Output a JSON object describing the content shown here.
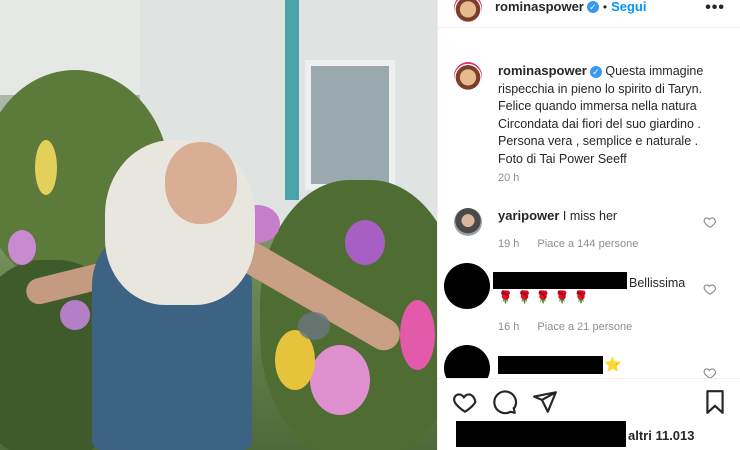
{
  "post": {
    "username": "rominaspower",
    "follow_label": "Segui",
    "more_label": "•••",
    "caption_lines": [
      "Questa immagine",
      "rispecchia in pieno lo spirito di Taryn.",
      "Felice quando immersa nella natura",
      "Circondata dai fiori del suo giardino .",
      "Persona vera , semplice e naturale .",
      "Foto di Tai Power Seeff"
    ],
    "caption_time": "20 h"
  },
  "comments": [
    {
      "username": "yaripower",
      "text": "I miss her",
      "time": "19 h",
      "likes": "Piace a 144 persone"
    },
    {
      "username": "",
      "text": "Bellissima",
      "emoji": "🌹🌹🌹🌹🌹",
      "time": "16 h",
      "likes": "Piace a 21 persone"
    },
    {
      "username": "",
      "text": "",
      "emoji": "⭐"
    }
  ],
  "footer": {
    "likes_text": "altri 11.013"
  },
  "icons": {
    "like": "heart-icon",
    "comment": "comment-icon",
    "share": "share-icon",
    "save": "bookmark-icon"
  },
  "colors": {
    "follow": "#0095f6",
    "verified": "#3897f0",
    "muted": "#8e8e8e"
  }
}
